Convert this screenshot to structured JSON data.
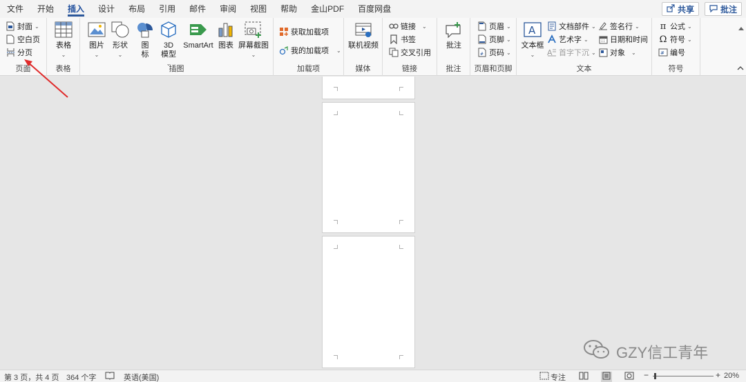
{
  "tabs": [
    "文件",
    "开始",
    "插入",
    "设计",
    "布局",
    "引用",
    "邮件",
    "审阅",
    "视图",
    "帮助",
    "金山PDF",
    "百度网盘"
  ],
  "active_tab": "插入",
  "header_buttons": {
    "share": "共享",
    "comment": "批注"
  },
  "ribbon": {
    "pages": {
      "label": "页面",
      "cover": "封面",
      "blank_page": "空白页",
      "page_break": "分页"
    },
    "tables": {
      "label": "表格",
      "table": "表格"
    },
    "illustrations": {
      "label": "插图",
      "pictures": "图片",
      "shapes": "形状",
      "icons": "图标",
      "model_3d": "3D模型",
      "smartart": "SmartArt",
      "chart": "图表",
      "screenshot": "屏幕截图"
    },
    "addins": {
      "label": "加载项",
      "get_addins": "获取加载项",
      "my_addins": "我的加载项"
    },
    "media": {
      "label": "媒体",
      "online_video": "联机视频"
    },
    "links": {
      "label": "链接",
      "link": "链接",
      "bookmark": "书签",
      "cross_reference": "交叉引用"
    },
    "comments": {
      "label": "批注",
      "comment": "批注"
    },
    "header_footer": {
      "label": "页眉和页脚",
      "header": "页眉",
      "footer": "页脚",
      "page_number": "页码"
    },
    "text": {
      "label": "文本",
      "text_box": "文本框",
      "quick_parts": "文档部件",
      "wordart": "艺术字",
      "drop_cap": "首字下沉",
      "signature_line": "签名行",
      "date_time": "日期和时间",
      "object": "对象"
    },
    "symbols": {
      "label": "符号",
      "equation": "公式",
      "symbol": "符号",
      "number": "编号"
    }
  },
  "status": {
    "page": "第 3 页，共 4 页",
    "words": "364 个字",
    "language": "英语(美国)",
    "focus": "专注",
    "zoom": "20%"
  },
  "watermark": "GZY信工青年",
  "colors": {
    "accent": "#2b579a",
    "arrow": "#e02a2a"
  }
}
